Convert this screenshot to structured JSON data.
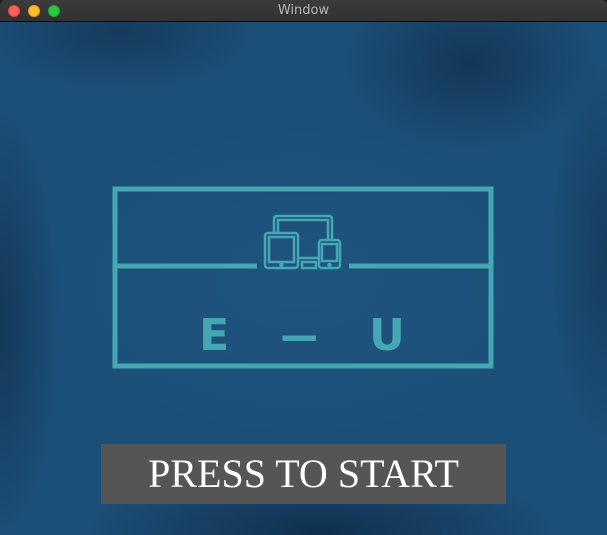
{
  "window": {
    "title": "Window"
  },
  "logo": {
    "letters": [
      "E",
      "—",
      "U"
    ],
    "color": "#44a7b3",
    "icon": "devices-icon"
  },
  "start_button": {
    "label": "PRESS TO START"
  },
  "colors": {
    "background": "#1c4f78",
    "button": "#555555",
    "button_text": "#ffffff"
  }
}
